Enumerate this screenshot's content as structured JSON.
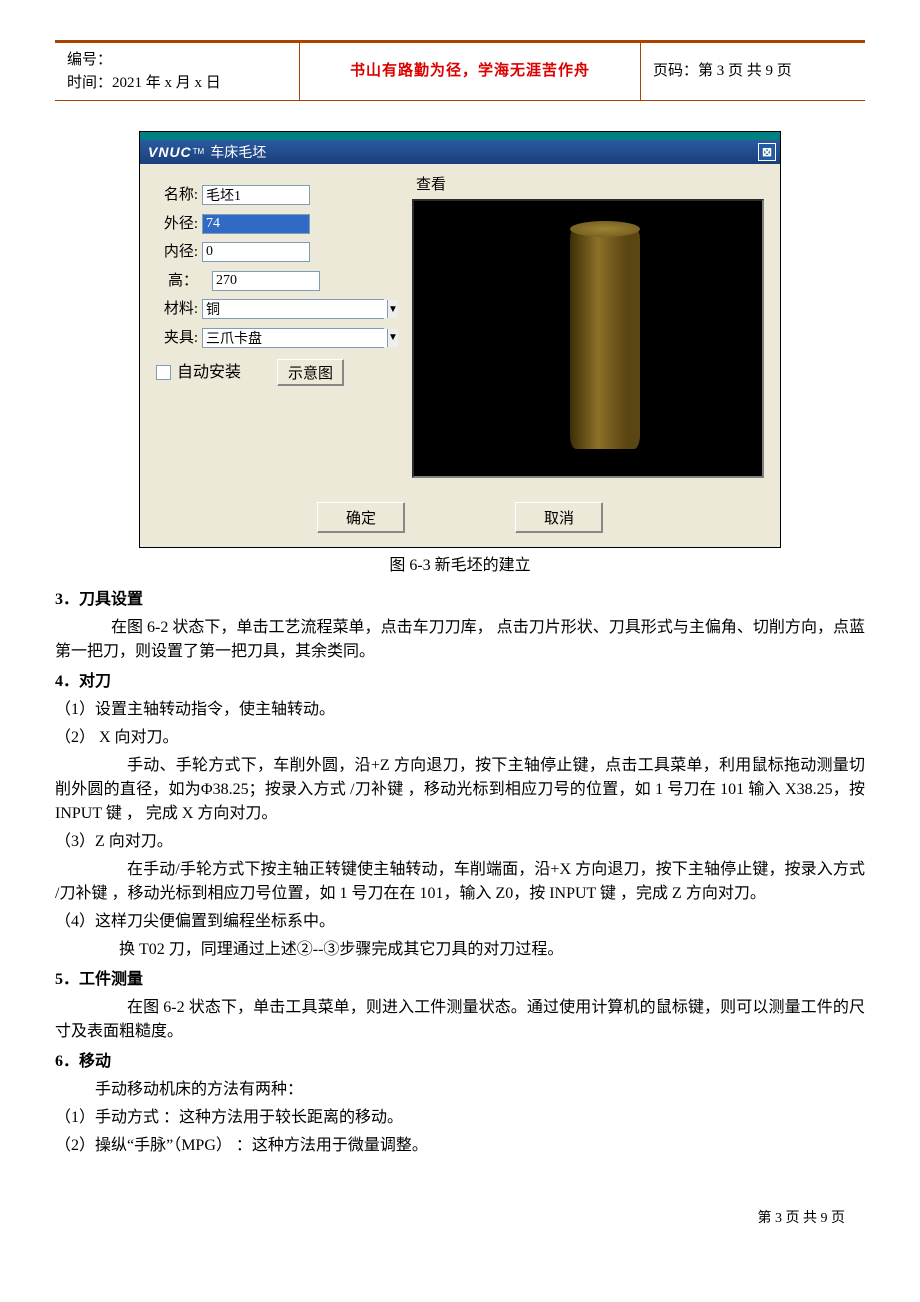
{
  "header": {
    "bianhao": "编号：",
    "shijian": "时间：2021 年 x 月 x 日",
    "slogan": "书山有路勤为径，学海无涯苦作舟",
    "yema": "页码：第 3 页 共 9 页"
  },
  "dialog": {
    "brand": "VNUC",
    "tm": "TM",
    "title": "车床毛坯",
    "view_label": "查看",
    "labels": {
      "name": "名称:",
      "od": "外径:",
      "id": "内径:",
      "h": "高：",
      "mat": "材料:",
      "fix": "夹具:"
    },
    "values": {
      "name": "毛坯1",
      "od": "74",
      "id": "0",
      "h": "270",
      "mat": "铜",
      "fix": "三爪卡盘"
    },
    "auto_install": "自动安装",
    "schematic_btn": "示意图",
    "ok": "确定",
    "cancel": "取消"
  },
  "caption": "图 6-3    新毛坯的建立",
  "sec3": {
    "title": "3．刀具设置",
    "p1": "在图 6-2 状态下，单击工艺流程菜单，点击车刀刀库，  点击刀片形状、刀具形式与主偏角、切削方向，点蓝第一把刀，则设置了第一把刀具，其余类同。"
  },
  "sec4": {
    "title": "4．对刀",
    "p1": "（1）设置主轴转动指令，使主轴转动。",
    "p2": "（2）  X 向对刀。",
    "p3": "手动、手轮方式下，车削外圆，沿+Z 方向退刀，按下主轴停止键，点击工具菜单，利用鼠标拖动测量切削外圆的直径，如为Φ38.25；按录入方式        /刀补键        ，移动光标到相应刀号的位置，如 1 号刀在 101 输入 X38.25，按 INPUT 键        ，  完成 X 方向对刀。",
    "p4": "（3）Z 向对刀。",
    "p5": "在手动/手轮方式下按主轴正转键使主轴转动，车削端面，沿+X 方向退刀，按下主轴停止键，按录入方式            /刀补键        ，移动光标到相应刀号位置，如 1 号刀在在 101，输入 Z0，按 INPUT 键        ，完成 Z 方向对刀。",
    "p6": "（4）这样刀尖便偏置到编程坐标系中。",
    "p7": "换 T02 刀，同理通过上述②--③步骤完成其它刀具的对刀过程。"
  },
  "sec5": {
    "title": "5．工件测量",
    "p1": "在图 6-2 状态下，单击工具菜单，则进入工件测量状态。通过使用计算机的鼠标键，则可以测量工件的尺寸及表面粗糙度。"
  },
  "sec6": {
    "title": "6．移动",
    "p1": "手动移动机床的方法有两种：",
    "p2": "（1）手动方式      ：这种方法用于较长距离的移动。",
    "p3": "（2）操纵“手脉”（MPG）    ：这种方法用于微量调整。"
  },
  "footer": "第  3  页  共  9  页"
}
